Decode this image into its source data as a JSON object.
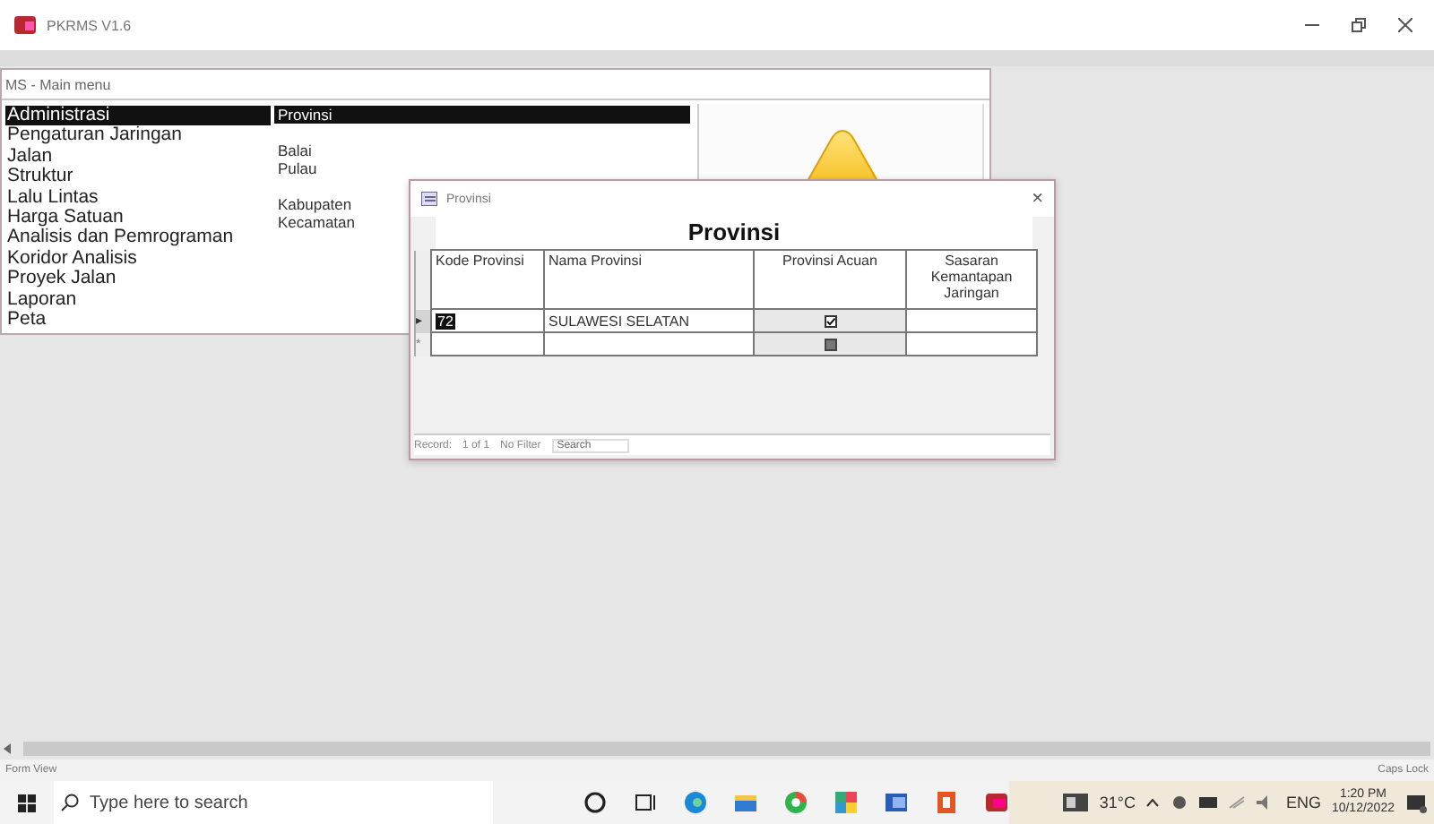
{
  "window": {
    "title": "PKRMS V1.6"
  },
  "main_menu": {
    "title": "MS - Main menu",
    "items": [
      {
        "label": "Administrasi",
        "selected": true
      },
      {
        "label": "Pengaturan Jaringan",
        "selected": false
      },
      {
        "label": "Jalan",
        "selected": false
      },
      {
        "label": "Struktur",
        "selected": false
      },
      {
        "label": "Lalu Lintas",
        "selected": false
      },
      {
        "label": "Harga Satuan",
        "selected": false
      },
      {
        "label": "Analisis dan Pemrograman",
        "selected": false
      },
      {
        "label": "Koridor Analisis",
        "selected": false
      },
      {
        "label": "Proyek Jalan",
        "selected": false
      },
      {
        "label": "Laporan",
        "selected": false
      },
      {
        "label": "Peta",
        "selected": false
      }
    ],
    "submenu_groups": [
      [
        {
          "label": "Provinsi",
          "selected": true
        }
      ],
      [
        {
          "label": "Balai",
          "selected": false
        },
        {
          "label": "Pulau",
          "selected": false
        }
      ],
      [
        {
          "label": "Kabupaten",
          "selected": false
        },
        {
          "label": "Kecamatan",
          "selected": false
        }
      ]
    ]
  },
  "dialog": {
    "title": "Provinsi",
    "close": "×",
    "heading": "Provinsi",
    "columns": [
      "Kode Provinsi",
      "Nama Provinsi",
      "Provinsi Acuan",
      "Sasaran Kemantapan Jaringan"
    ],
    "rows": [
      {
        "selector": "▸",
        "kode": "72",
        "nama": "SULAWESI SELATAN",
        "acuan": true,
        "selected": true
      },
      {
        "selector": "*",
        "kode": "",
        "nama": "",
        "acuan": false,
        "selected": false
      }
    ],
    "navigation": {
      "label": "Record:",
      "position": "1 of 1",
      "filter": "No Filter",
      "search_placeholder": "Search"
    }
  },
  "status_bar": {
    "left": "Form View",
    "right": "Caps Lock"
  },
  "taskbar": {
    "search_placeholder": "Type here to search",
    "weather": "31°C",
    "language": "ENG",
    "time": "1:20 PM",
    "date": "10/12/2022"
  }
}
